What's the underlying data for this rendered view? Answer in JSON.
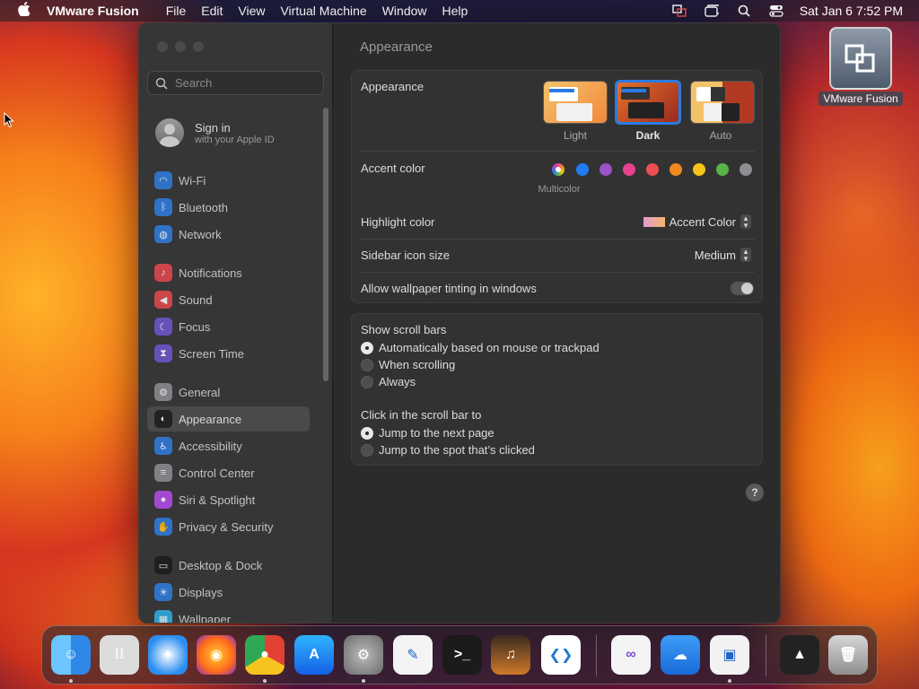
{
  "menubar": {
    "app_name": "VMware Fusion",
    "menus": [
      "File",
      "Edit",
      "View",
      "Virtual Machine",
      "Window",
      "Help"
    ],
    "clock": "Sat Jan 6  7:52 PM"
  },
  "desktop": {
    "icon_label": "VMware Fusion"
  },
  "sidebar": {
    "search_placeholder": "Search",
    "signin_title": "Sign in",
    "signin_subtitle": "with your Apple ID",
    "items": [
      {
        "label": "Wi-Fi",
        "icon": "wifi-icon",
        "color": "#2f7de1"
      },
      {
        "label": "Bluetooth",
        "icon": "bluetooth-icon",
        "color": "#2f7de1"
      },
      {
        "label": "Network",
        "icon": "network-globe-icon",
        "color": "#2f7de1"
      },
      {
        "label": "Notifications",
        "icon": "bell-icon",
        "color": "#e5484d"
      },
      {
        "label": "Sound",
        "icon": "speaker-icon",
        "color": "#e5484d"
      },
      {
        "label": "Focus",
        "icon": "moon-icon",
        "color": "#6e56cf"
      },
      {
        "label": "Screen Time",
        "icon": "hourglass-icon",
        "color": "#6e56cf"
      },
      {
        "label": "General",
        "icon": "gear-icon",
        "color": "#8e8e93"
      },
      {
        "label": "Appearance",
        "icon": "appearance-icon",
        "color": "#1c1c1e"
      },
      {
        "label": "Accessibility",
        "icon": "accessibility-icon",
        "color": "#2f7de1"
      },
      {
        "label": "Control Center",
        "icon": "control-center-icon",
        "color": "#8e8e93"
      },
      {
        "label": "Siri & Spotlight",
        "icon": "siri-icon",
        "color": "#b84cf0"
      },
      {
        "label": "Privacy & Security",
        "icon": "hand-icon",
        "color": "#2f7de1"
      },
      {
        "label": "Desktop & Dock",
        "icon": "dock-icon",
        "color": "#1c1c1e"
      },
      {
        "label": "Displays",
        "icon": "sun-icon",
        "color": "#2f7de1"
      },
      {
        "label": "Wallpaper",
        "icon": "wallpaper-icon",
        "color": "#2fb0e8"
      }
    ],
    "selected": "Appearance"
  },
  "content": {
    "title": "Appearance",
    "appearance_label": "Appearance",
    "modes": [
      {
        "label": "Light",
        "selected": false
      },
      {
        "label": "Dark",
        "selected": true
      },
      {
        "label": "Auto",
        "selected": false
      }
    ],
    "accent_label": "Accent color",
    "accent_colors": [
      "multicolor",
      "#1f7cf5",
      "#9b52c7",
      "#e8418f",
      "#ec4f55",
      "#f08a1f",
      "#f5c518",
      "#5ab34a",
      "#8e8e93"
    ],
    "accent_selected_name": "Multicolor",
    "highlight_label": "Highlight color",
    "highlight_value": "Accent Color",
    "icon_size_label": "Sidebar icon size",
    "icon_size_value": "Medium",
    "tinting_label": "Allow wallpaper tinting in windows",
    "scroll_title": "Show scroll bars",
    "scroll_options": [
      "Automatically based on mouse or trackpad",
      "When scrolling",
      "Always"
    ],
    "click_title": "Click in the scroll bar to",
    "click_options": [
      "Jump to the next page",
      "Jump to the spot that’s clicked"
    ],
    "help": "?"
  },
  "dock": {
    "apps": [
      "Finder",
      "Launchpad",
      "Safari",
      "Firefox",
      "Chrome",
      "App Store",
      "System Settings",
      "TextEdit",
      "Terminal",
      "GarageBand",
      "Visual Studio Code",
      "Visual Studio",
      "iCloud",
      "VMware Fusion",
      "Downloads",
      "Trash"
    ]
  }
}
